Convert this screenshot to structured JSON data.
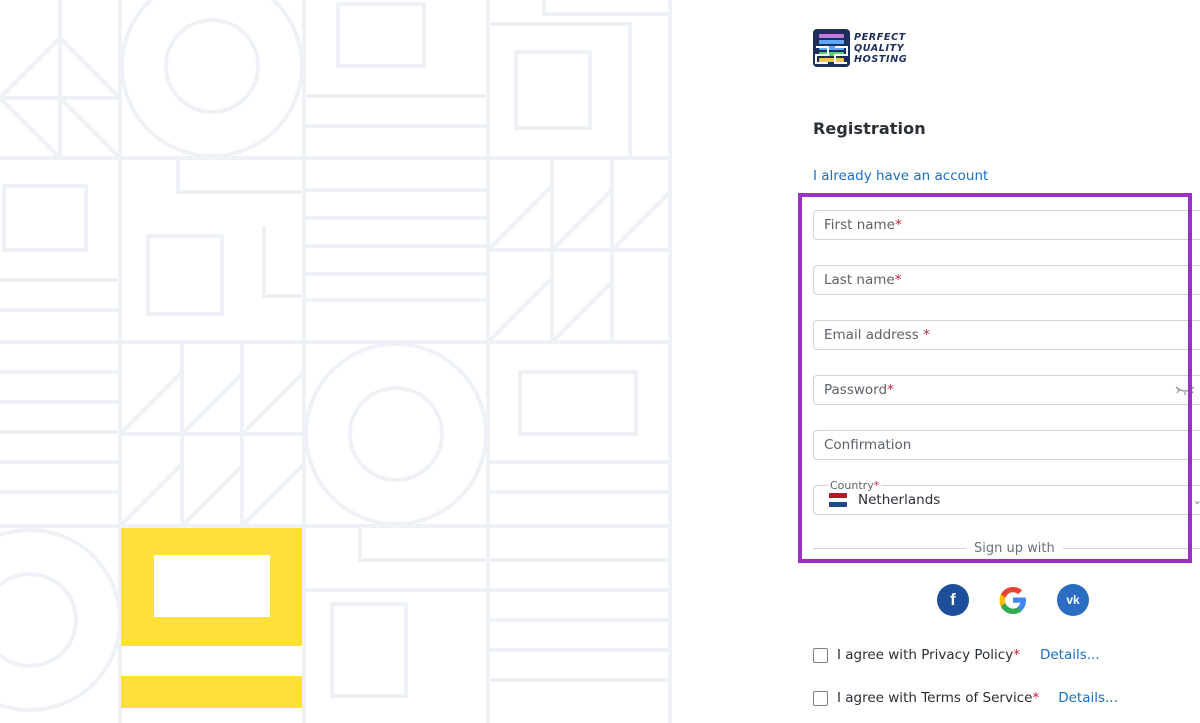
{
  "brand": {
    "logo_lines": [
      "PERFECT",
      "QUALITY",
      "HOSTING"
    ]
  },
  "form": {
    "title": "Registration",
    "login_link": "I already have an account",
    "first_name": "First name",
    "last_name": "Last name",
    "email": "Email address ",
    "password": "Password",
    "confirmation": "Confirmation",
    "required_mark": "*",
    "country_label": "Country",
    "country_value": "Netherlands",
    "sign_up_with": "Sign up with"
  },
  "social": {
    "facebook": "f",
    "vk": "vk"
  },
  "agreements": {
    "privacy_label": "I agree with Privacy Policy",
    "terms_label": "I agree with Terms of Service",
    "details_text": "Details..."
  },
  "colors": {
    "accent_link": "#1a6fc9",
    "highlight": "#9b32c8",
    "required": "#c41e3a",
    "pattern_yellow": "#ffe03a",
    "pattern_line": "#eef2f6"
  }
}
